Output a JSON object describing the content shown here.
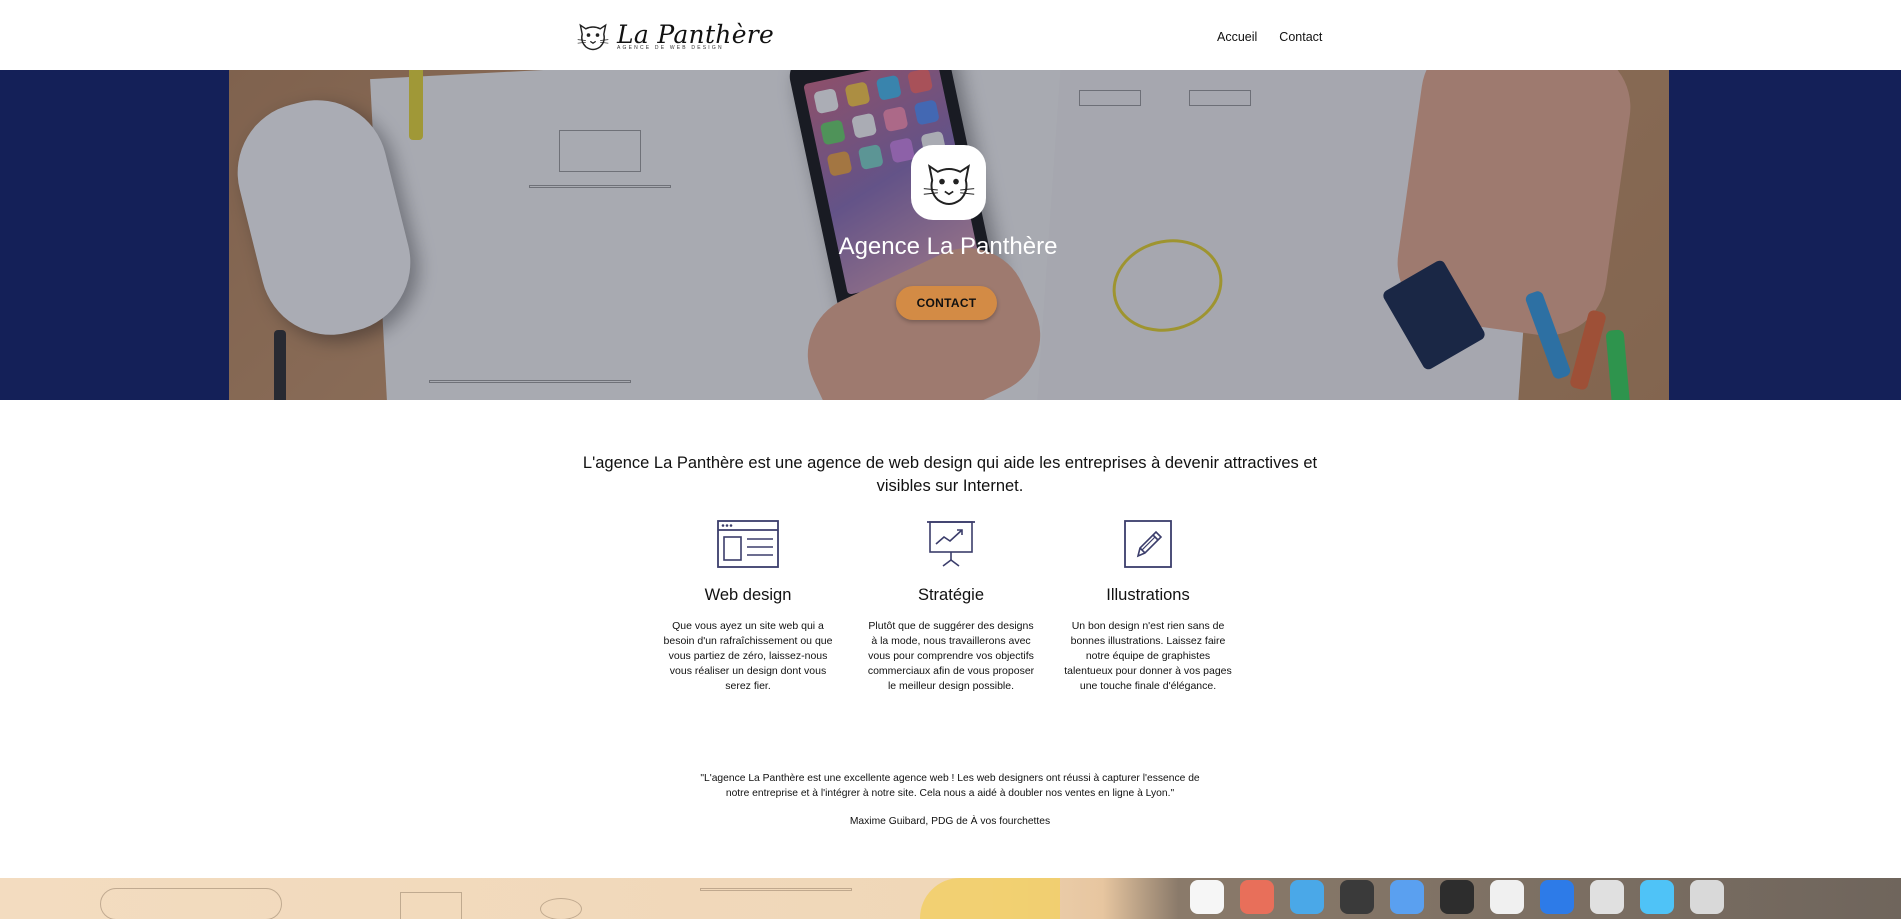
{
  "header": {
    "brand_name": "La Panthère",
    "brand_tagline": "AGENCE DE WEB DESIGN",
    "nav": [
      {
        "label": "Accueil"
      },
      {
        "label": "Contact"
      }
    ]
  },
  "hero": {
    "title": "Agence La Panthère",
    "button_label": "CONTACT",
    "button_color": "#d38b45",
    "band_color": "#142058"
  },
  "intro": {
    "text": "L'agence La Panthère est une agence de web design qui aide les entreprises à devenir attractives et visibles sur Internet."
  },
  "services": [
    {
      "icon": "browser-layout-icon",
      "title": "Web design",
      "text": "Que vous ayez un site web qui a besoin d'un rafraîchissement ou que vous partiez de zéro, laissez-nous vous réaliser un design dont vous serez fier."
    },
    {
      "icon": "presentation-chart-icon",
      "title": "Stratégie",
      "text": "Plutôt que de suggérer des designs à la mode, nous travaillerons avec vous pour comprendre vos objectifs commerciaux afin de vous proposer le meilleur design possible."
    },
    {
      "icon": "pencil-edit-icon",
      "title": "Illustrations",
      "text": "Un bon design n'est rien sans de bonnes illustrations. Laissez faire notre équipe de graphistes talentueux pour donner à vos pages une touche finale d'élégance."
    }
  ],
  "testimonial": {
    "quote": "\"L'agence La Panthère est une excellente agence web ! Les web designers ont réussi à capturer l'essence de notre entreprise et à l'intégrer à notre site. Cela nous a aidé à doubler nos ventes en ligne à Lyon.\"",
    "author": "Maxime Guibard, PDG de À vos fourchettes"
  },
  "colors": {
    "icon_stroke": "#3b3d6b",
    "text": "#111111"
  }
}
